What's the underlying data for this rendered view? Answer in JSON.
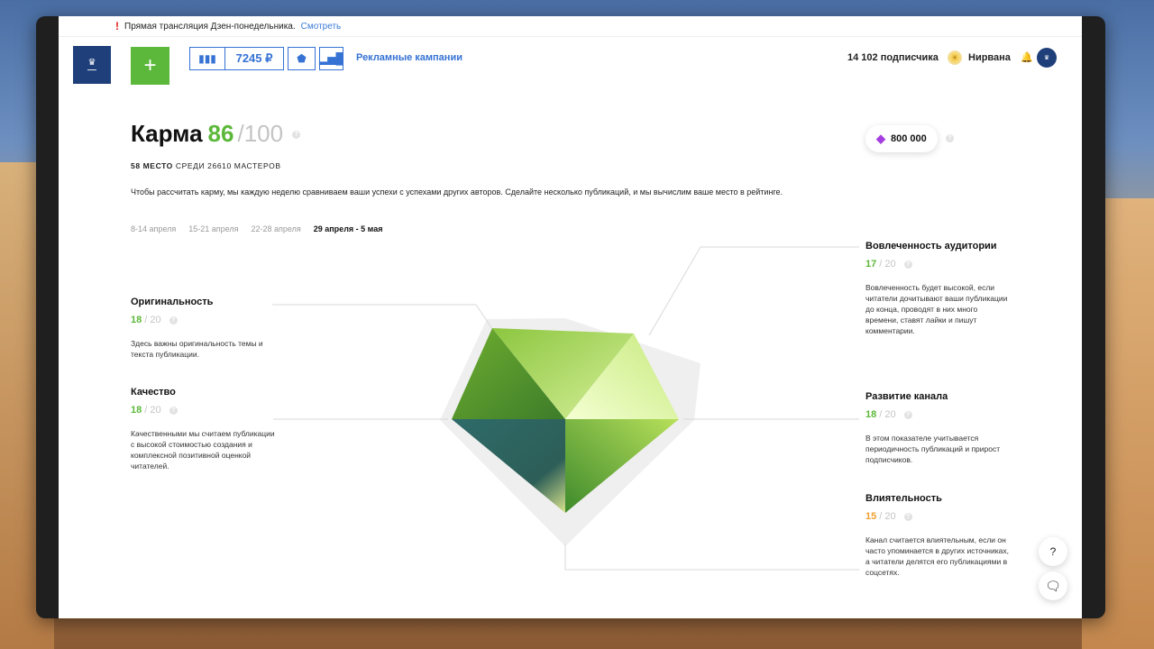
{
  "notice": {
    "text": "Прямая трансляция Дзен-понедельника.",
    "link": "Смотреть"
  },
  "toolbar": {
    "money": "7245 ₽",
    "ads_link": "Рекламные кампании"
  },
  "header": {
    "subscribers": "14 102 подписчика",
    "nirvana": "Нирвана"
  },
  "karma": {
    "title": "Карма",
    "score": "86",
    "max": "/100",
    "place_bold": "58 место",
    "place_rest": "среди 26610 мастеров",
    "description": "Чтобы рассчитать карму, мы каждую неделю сравниваем ваши успехи с успехами других авторов. Сделайте несколько публикаций, и мы вычислим ваше место в рейтинге."
  },
  "weeks": [
    "8-14 апреля",
    "15-21 апреля",
    "22-28 апреля",
    "29 апреля - 5 мая"
  ],
  "active_week_index": 3,
  "crystals": "800 000",
  "metrics": {
    "originality": {
      "title": "Оригинальность",
      "score": "18",
      "max": "/ 20",
      "desc": "Здесь важны оригинальность темы и текста публикации."
    },
    "quality": {
      "title": "Качество",
      "score": "18",
      "max": "/ 20",
      "desc": "Качественными мы считаем публикации с высокой стоимостью создания и комплексной позитивной оценкой читателей."
    },
    "engagement": {
      "title": "Вовлеченность аудитории",
      "score": "17",
      "max": "/ 20",
      "desc": "Вовлеченность будет высокой, если читатели дочитывают ваши публикации до конца, проводят в них много времени, ставят лайки и пишут комментарии."
    },
    "growth": {
      "title": "Развитие канала",
      "score": "18",
      "max": "/ 20",
      "desc": "В этом показателе учитывается периодичность публикаций и прирост подписчиков."
    },
    "influence": {
      "title": "Влиятельность",
      "score": "15",
      "max": "/ 20",
      "desc": "Канал считается влиятельным, если он часто упоминается в других источниках, а читатели делятся его публикациями в соцсетях."
    }
  },
  "colors": {
    "accent_green": "#5cb83a",
    "accent_blue": "#3572d4",
    "warn_orange": "#f0a030",
    "crystal_purple": "#a43ee0"
  },
  "help_button": "?"
}
